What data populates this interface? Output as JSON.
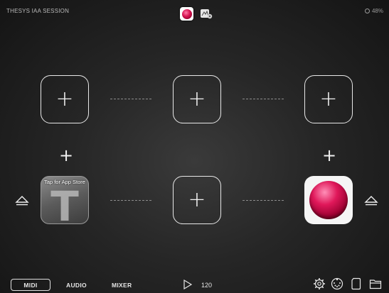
{
  "header": {
    "app_title": "THESYS IAA SESSION",
    "battery": "48%",
    "host_icon": "host-app-icon",
    "iaa_icon": "iaa-link-icon"
  },
  "slots": {
    "add_symbol": "+",
    "thesys_app_label": "Tap for App Store",
    "thesys_letter": "T"
  },
  "footer": {
    "tabs": [
      "MIDI",
      "AUDIO",
      "MIXER"
    ],
    "selected_tab": "MIDI",
    "tempo": "120",
    "icons": [
      "play-icon",
      "settings-icon",
      "midi-port-icon",
      "document-icon",
      "folder-icon"
    ]
  },
  "colors": {
    "accent": "#d6124f",
    "outline": "#e8e8e8"
  }
}
